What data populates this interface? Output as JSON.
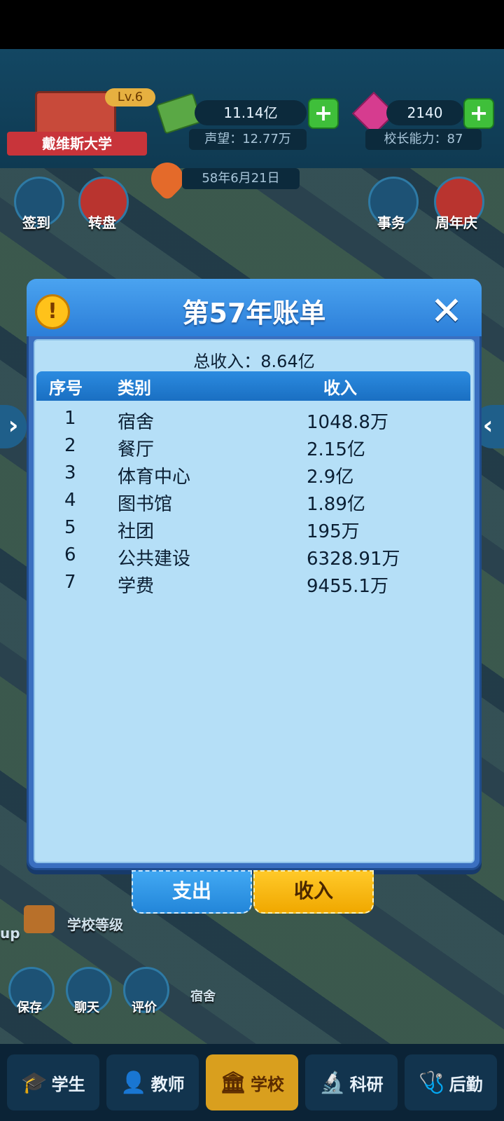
{
  "school": {
    "name": "戴维斯大学",
    "level": "Lv.6"
  },
  "resources": {
    "money": "11.14亿",
    "reputation_label": "声望：",
    "reputation_value": "12.77万",
    "gems": "2140",
    "principal_label": "校长能力：",
    "principal_value": "87"
  },
  "date": "58年6月21日",
  "left_buttons": [
    {
      "label": "签到"
    },
    {
      "label": "转盘"
    }
  ],
  "right_buttons": [
    {
      "label": "事务"
    },
    {
      "label": "周年庆"
    }
  ],
  "dialog": {
    "title": "第57年账单",
    "total_label": "总收入：",
    "total_value": "8.64亿",
    "columns": [
      "序号",
      "类别",
      "收入"
    ],
    "rows": [
      {
        "index": "1",
        "category": "宿舍",
        "income": "1048.8万"
      },
      {
        "index": "2",
        "category": "餐厅",
        "income": "2.15亿"
      },
      {
        "index": "3",
        "category": "体育中心",
        "income": "2.9亿"
      },
      {
        "index": "4",
        "category": "图书馆",
        "income": "1.89亿"
      },
      {
        "index": "5",
        "category": "社团",
        "income": "195万"
      },
      {
        "index": "6",
        "category": "公共建设",
        "income": "6328.91万"
      },
      {
        "index": "7",
        "category": "学费",
        "income": "9455.1万"
      }
    ],
    "tab_expense": "支出",
    "tab_income": "收入"
  },
  "background_labels": {
    "school_level": "学校等级",
    "building": "宿舍",
    "edge_text": "up"
  },
  "side_buttons": [
    {
      "label": "保存"
    },
    {
      "label": "聊天"
    },
    {
      "label": "评价"
    }
  ],
  "bottom_nav": [
    {
      "label": "学生",
      "icon": "graduation-cap-icon",
      "glyph": "🎓"
    },
    {
      "label": "教师",
      "icon": "person-icon",
      "glyph": "👤"
    },
    {
      "label": "学校",
      "icon": "building-columns-icon",
      "glyph": "🏛"
    },
    {
      "label": "科研",
      "icon": "microscope-icon",
      "glyph": "🔬"
    },
    {
      "label": "后勤",
      "icon": "first-aid-icon",
      "glyph": "🩺"
    }
  ],
  "colors": {
    "accent_blue": "#2c7ed8",
    "accent_gold": "#f0a800",
    "panel": "#b5dff7"
  }
}
